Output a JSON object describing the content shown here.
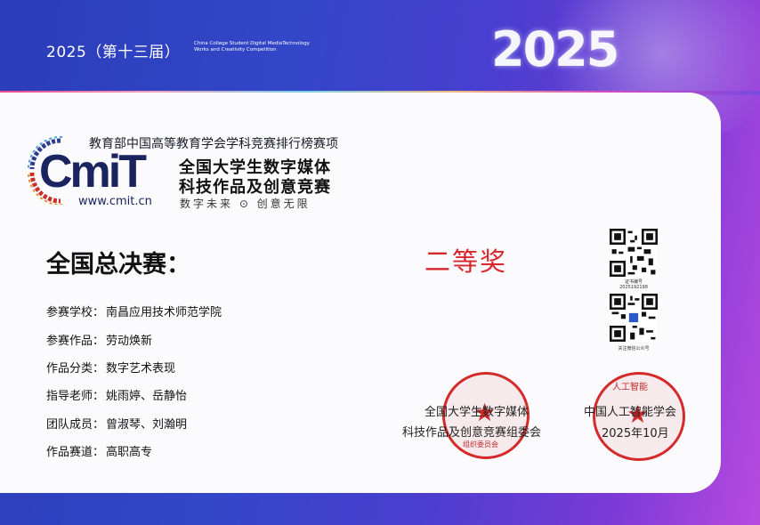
{
  "header": {
    "year_session": "2025（第十三届）",
    "english_line1": "China College Student Digital MediaTechnology",
    "english_line2": "Works and Creativity Competition",
    "big_year": "2025"
  },
  "logo": {
    "ranking_text": "教育部中国高等教育学会学科竞赛排行榜赛项",
    "brand": "CmiT",
    "url": "www.cmit.cn",
    "competition_line1": "全国大学生数字媒体",
    "competition_line2": "科技作品及创意竞赛",
    "slogan": "数字未来 ⊙ 创意无限"
  },
  "certificate": {
    "stage": "全国总决赛：",
    "award": "二等奖",
    "fields": [
      {
        "label": "参赛学校：",
        "value": "南昌应用技术师范学院"
      },
      {
        "label": "参赛作品：",
        "value": "劳动焕新"
      },
      {
        "label": "作品分类：",
        "value": "数字艺术表现"
      },
      {
        "label": "指导老师：",
        "value": "姚雨婷、岳静怡"
      },
      {
        "label": "团队成员：",
        "value": "曾淑琴、刘瀚明"
      },
      {
        "label": "作品赛道：",
        "value": "高职高专"
      }
    ]
  },
  "qr": {
    "cert_label": "证书编号",
    "cert_number": "2025192198",
    "follow_label": "关注微信公众号"
  },
  "seals": {
    "left_line1": "全国大学生数字媒体",
    "left_line2": "科技作品及创意竞赛组委会",
    "left_stamp_text": "组织委员会",
    "right_line1": "中国人工智能学会",
    "right_line2": "2025年10月",
    "right_stamp_text": "人工智能"
  },
  "colors": {
    "award_red": "#d8262c",
    "seal_red": "#d42a2a",
    "brand_navy": "#1a2460"
  }
}
